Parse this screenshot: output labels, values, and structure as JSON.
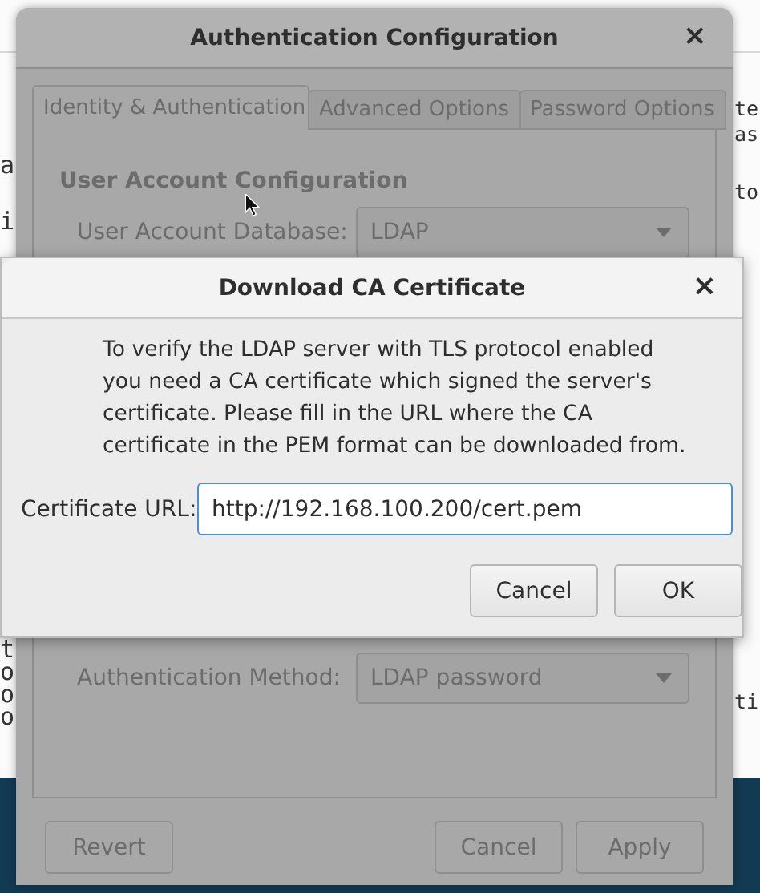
{
  "background": {
    "left_text": [
      "a",
      "i",
      "t",
      "o",
      "o",
      "o"
    ],
    "right_text": [
      "te",
      "as",
      "to",
      "ti"
    ]
  },
  "main_window": {
    "title": "Authentication Configuration",
    "close": "×",
    "dimmed": true,
    "tabs": [
      {
        "label": "Identity & Authentication",
        "selected": true
      },
      {
        "label": "Advanced Options",
        "selected": false
      },
      {
        "label": "Password Options",
        "selected": false
      }
    ],
    "section_title": "User Account Configuration",
    "fields": [
      {
        "label": "User Account Database:",
        "value": "LDAP"
      },
      {
        "label": "Authentication Method:",
        "value": "LDAP password"
      }
    ],
    "buttons": [
      {
        "label": "Revert"
      },
      {
        "label": "Cancel"
      },
      {
        "label": "Apply"
      }
    ]
  },
  "dialog": {
    "title": "Download CA Certificate",
    "close": "×",
    "message": "To verify the LDAP server with TLS protocol enabled you need a CA certificate which signed the server's certificate. Please fill in the URL where the CA certificate in the PEM format can be downloaded from.",
    "field_label": "Certificate URL:",
    "field_value": "http://192.168.100.200/cert.pem",
    "buttons": [
      {
        "label": "Cancel"
      },
      {
        "label": "OK"
      }
    ]
  }
}
